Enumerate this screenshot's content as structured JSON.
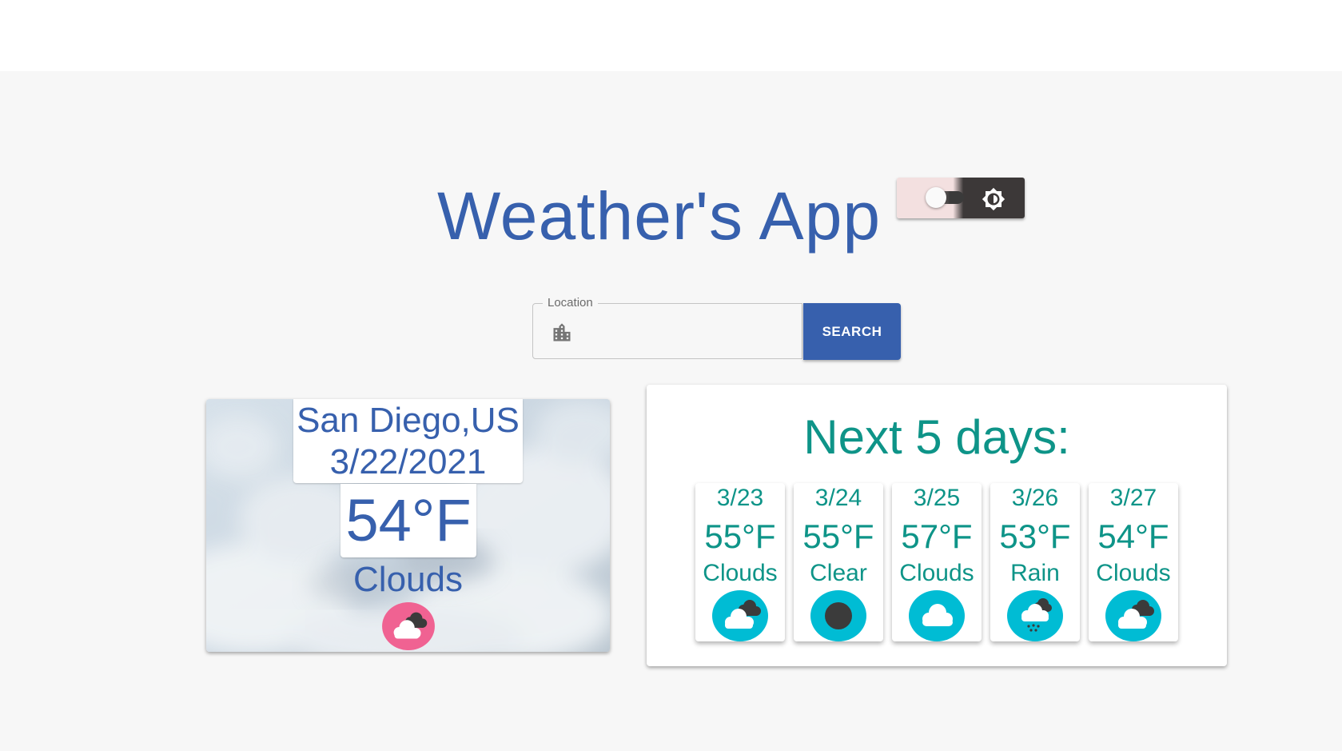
{
  "app": {
    "title": "Weather's App"
  },
  "theme_toggle": {
    "state": "off",
    "icon": "brightness-icon"
  },
  "search": {
    "label": "Location",
    "value": "",
    "placeholder": "",
    "icon": "city-icon",
    "button_label": "SEARCH"
  },
  "current": {
    "city": "San Diego,US",
    "date": "3/22/2021",
    "temperature": "54°F",
    "condition": "Clouds",
    "icon": "clouds-icon"
  },
  "forecast": {
    "title": "Next 5 days:",
    "days": [
      {
        "date": "3/23",
        "temp": "55°F",
        "condition": "Clouds",
        "icon": "clouds-icon"
      },
      {
        "date": "3/24",
        "temp": "55°F",
        "condition": "Clear",
        "icon": "clear-icon"
      },
      {
        "date": "3/25",
        "temp": "57°F",
        "condition": "Clouds",
        "icon": "cloud-icon"
      },
      {
        "date": "3/26",
        "temp": "53°F",
        "condition": "Rain",
        "icon": "rain-icon"
      },
      {
        "date": "3/27",
        "temp": "54°F",
        "condition": "Clouds",
        "icon": "clouds-icon"
      }
    ]
  },
  "colors": {
    "primary": "#3760ad",
    "accent_teal": "#0e9488",
    "icon_cyan": "#00bcd4",
    "icon_pink": "#f06292",
    "background": "#f7f7f7"
  }
}
